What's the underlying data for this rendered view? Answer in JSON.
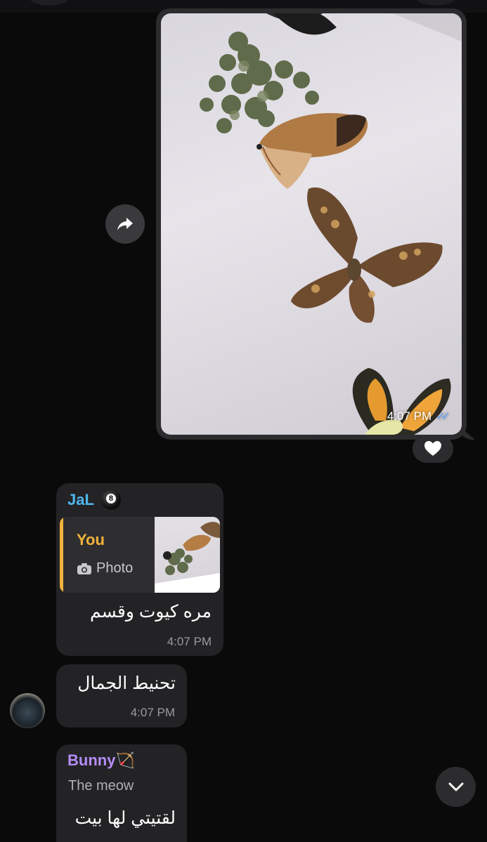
{
  "outgoing_photo": {
    "time": "4:07 PM",
    "status": "read",
    "status_icon": "double-check-icon",
    "reaction": "🤍"
  },
  "forward_button": {
    "icon": "share-arrow-icon"
  },
  "messages": [
    {
      "sender": "JaL",
      "sender_emoji": "8",
      "sender_color": "#4fb6ee",
      "reply": {
        "name": "You",
        "type_label": "Photo",
        "type_icon": "camera-icon",
        "accent": "#f1b33b"
      },
      "text": "مره كيوت وقسم",
      "time": "4:07 PM"
    },
    {
      "text": "تحنيط الجمال",
      "time": "4:07 PM"
    },
    {
      "sender": "Bunny🏹",
      "sender_color": "#b58cf7",
      "subtitle": "The meow",
      "text": "لقتيتي لها بيت"
    }
  ],
  "scroll_down_button": {
    "icon": "chevron-down-icon"
  }
}
